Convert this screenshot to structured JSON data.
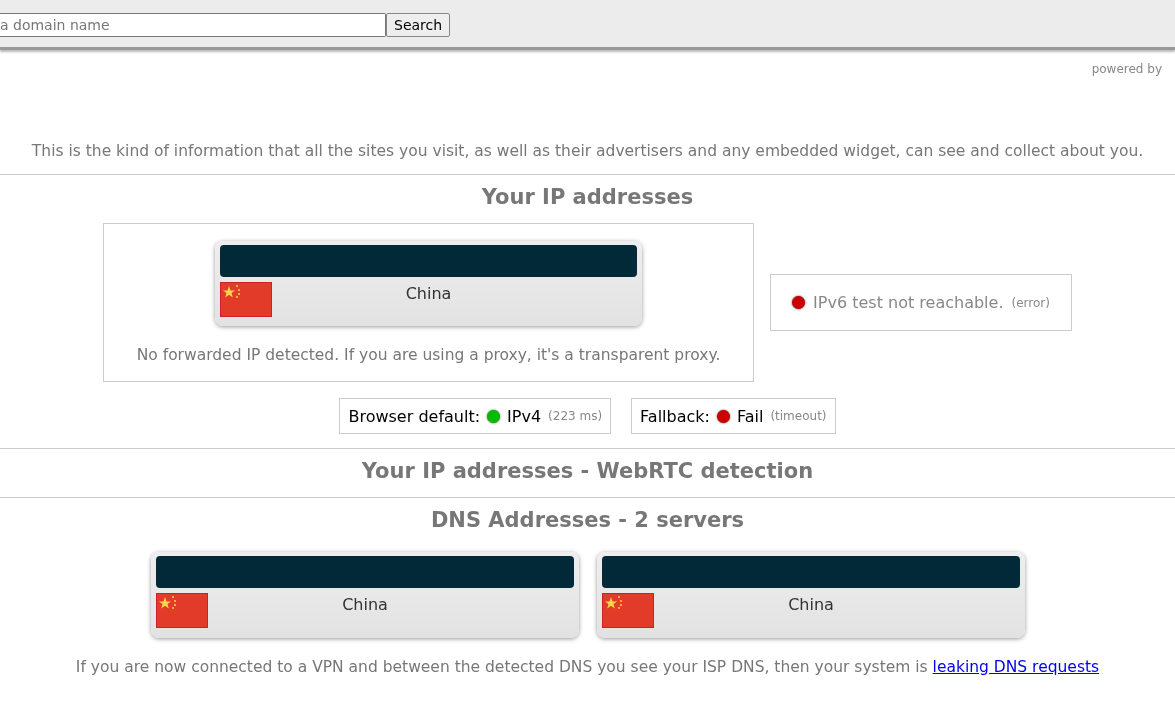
{
  "search": {
    "placeholder": "a domain name",
    "button": "Search"
  },
  "powered_by": "powered by",
  "intro": "This is the kind of information that all the sites you visit, as well as their advertisers and any embedded widget, can see and collect about you.",
  "ip_section": {
    "heading": "Your IP addresses",
    "cards": [
      {
        "country": "China"
      }
    ],
    "forwarded_note": "No forwarded IP detected. If you are using a proxy, it's a transparent proxy.",
    "ipv6": {
      "text": "IPv6 test not reachable.",
      "detail": "(error)",
      "color": "#cc0000"
    },
    "protocols": [
      {
        "label": "Browser default:",
        "value": "IPv4",
        "detail": "(223 ms)",
        "color": "#00bb00"
      },
      {
        "label": "Fallback:",
        "value": "Fail",
        "detail": "(timeout)",
        "color": "#cc0000"
      }
    ]
  },
  "webrtc_section": {
    "heading": "Your IP addresses - WebRTC detection"
  },
  "dns_section": {
    "heading": "DNS Addresses - 2 servers",
    "cards": [
      {
        "country": "China"
      },
      {
        "country": "China"
      }
    ],
    "note": "If you are now connected to a VPN and between the detected DNS you see your ISP DNS, then your system is",
    "link": "leaking DNS requests"
  }
}
